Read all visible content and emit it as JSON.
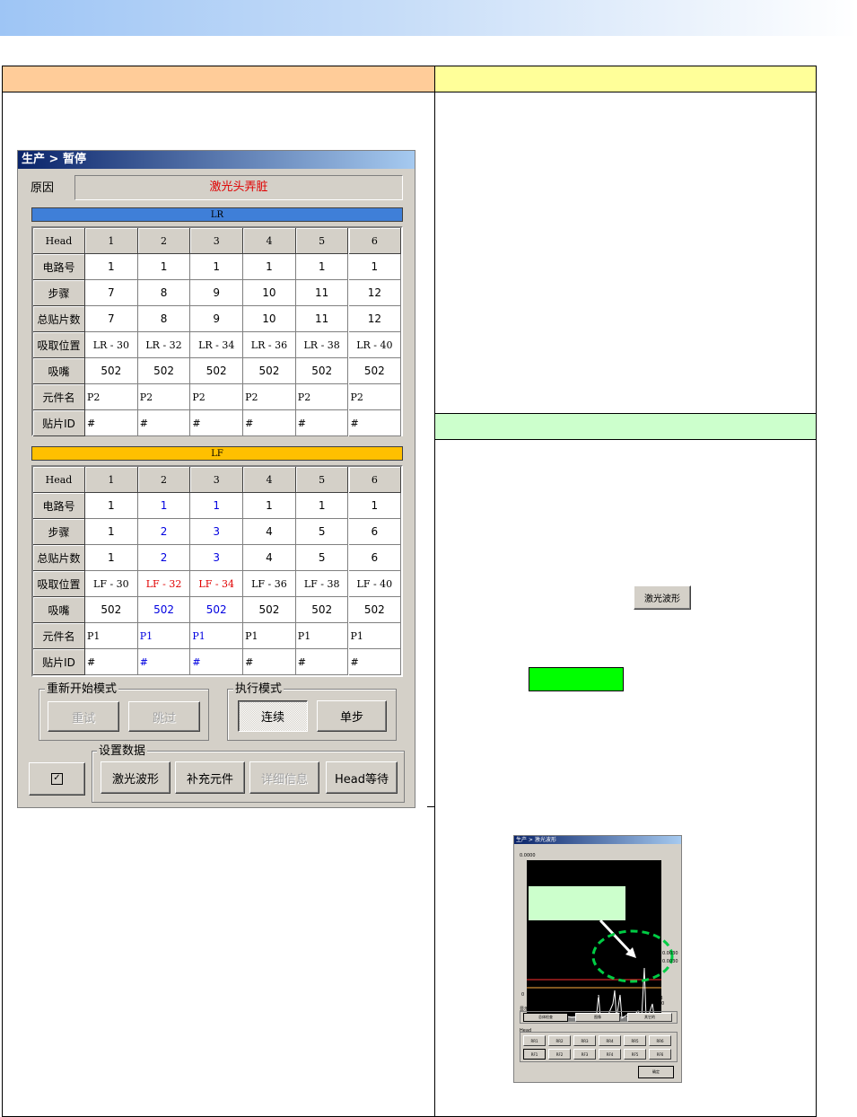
{
  "dialog": {
    "title": "生产 > 暂停",
    "reason_label": "原因",
    "reason_value": "激光头弄脏",
    "lr_bar": "LR",
    "lf_bar": "LF",
    "lr_table": {
      "header": [
        "Head",
        "1",
        "2",
        "3",
        "4",
        "5",
        "6"
      ],
      "rows": [
        {
          "label": "电路号",
          "cells": [
            "1",
            "1",
            "1",
            "1",
            "1",
            "1"
          ]
        },
        {
          "label": "步骤",
          "cells": [
            "7",
            "8",
            "9",
            "10",
            "11",
            "12"
          ]
        },
        {
          "label": "总贴片数",
          "cells": [
            "7",
            "8",
            "9",
            "10",
            "11",
            "12"
          ]
        },
        {
          "label": "吸取位置",
          "cells": [
            "LR - 30",
            "LR - 32",
            "LR - 34",
            "LR - 36",
            "LR - 38",
            "LR - 40"
          ]
        },
        {
          "label": "吸嘴",
          "cells": [
            "502",
            "502",
            "502",
            "502",
            "502",
            "502"
          ]
        },
        {
          "label": "元件名",
          "cells": [
            "P2",
            "P2",
            "P2",
            "P2",
            "P2",
            "P2"
          ]
        },
        {
          "label": "贴片ID",
          "cells": [
            "#",
            "#",
            "#",
            "#",
            "#",
            "#"
          ]
        }
      ]
    },
    "lf_table": {
      "header": [
        "Head",
        "1",
        "2",
        "3",
        "4",
        "5",
        "6"
      ],
      "rows": [
        {
          "label": "电路号",
          "cells": [
            "1",
            "1",
            "1",
            "1",
            "1",
            "1"
          ]
        },
        {
          "label": "步骤",
          "cells": [
            "1",
            "2",
            "3",
            "4",
            "5",
            "6"
          ]
        },
        {
          "label": "总贴片数",
          "cells": [
            "1",
            "2",
            "3",
            "4",
            "5",
            "6"
          ]
        },
        {
          "label": "吸取位置",
          "cells": [
            "LF - 30",
            "LF - 32",
            "LF - 34",
            "LF - 36",
            "LF - 38",
            "LF - 40"
          ]
        },
        {
          "label": "吸嘴",
          "cells": [
            "502",
            "502",
            "502",
            "502",
            "502",
            "502"
          ]
        },
        {
          "label": "元件名",
          "cells": [
            "P1",
            "P1",
            "P1",
            "P1",
            "P1",
            "P1"
          ]
        },
        {
          "label": "贴片ID",
          "cells": [
            "#",
            "#",
            "#",
            "#",
            "#",
            "#"
          ]
        }
      ]
    },
    "restart_group": "重新开始模式",
    "retry_button": "重试",
    "skip_button": "跳过",
    "exec_group": "执行模式",
    "continuous_button": "连续",
    "step_button": "单步",
    "settings_group": "设置数据",
    "laser_wave_button": "激光波形",
    "supply_button": "补充元件",
    "detail_button": "详细信息",
    "head_wait_button": "Head等待",
    "check_icon": "checkbox-icon"
  },
  "right_panel": {
    "laser_wave_button": "激光波形"
  },
  "waveform": {
    "title": "生产 > 激光波形",
    "top_value": "0.0000",
    "y_marks": [
      "0.0030",
      "0.0030"
    ],
    "x_zero": "0",
    "x_labels": [
      "RF1\n0.00",
      "RF2",
      "RF3\n0.00"
    ],
    "display_label": "显示",
    "mode_buttons": [
      "总体检查",
      "图像",
      "其它的"
    ],
    "head_label": "Head",
    "head_row1": [
      "RR1",
      "RR2",
      "RR3",
      "RR4",
      "RR5",
      "RR6"
    ],
    "head_row2": [
      "RF1",
      "RF2",
      "RF3",
      "RF4",
      "RF5",
      "RF6"
    ],
    "ok_button": "确定"
  },
  "colors": {
    "lr_bar": "#3f7fd8",
    "lf_bar": "#ffc000",
    "left_header": "#ffcc99",
    "right_header_top": "#ffff99",
    "right_header_mid": "#ccffcc",
    "green_box": "#00ff00"
  }
}
